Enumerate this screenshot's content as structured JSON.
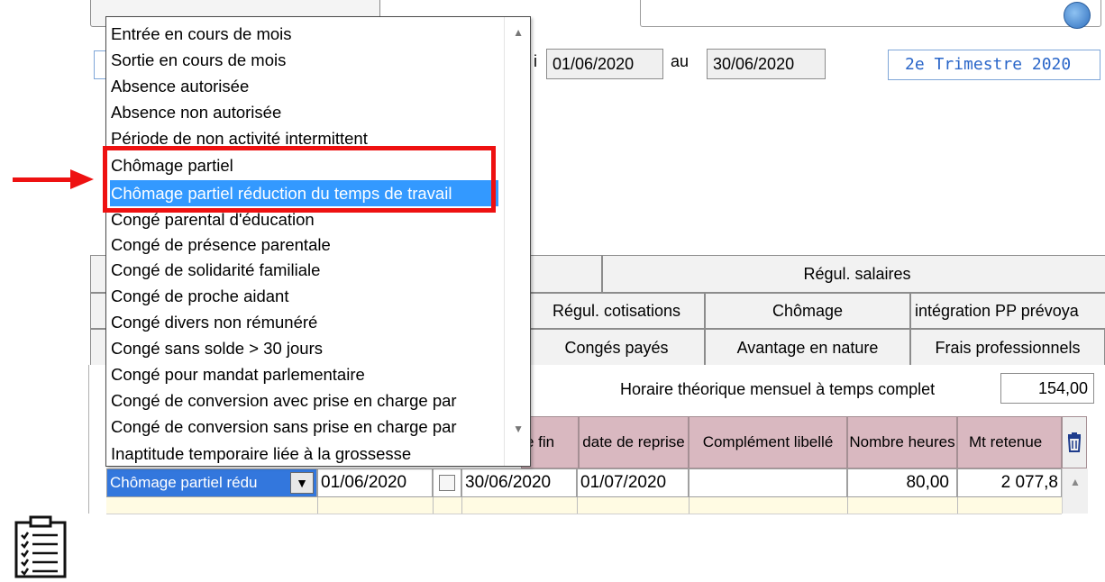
{
  "header": {
    "period_start": "01/06/2020",
    "period_to_label": "au",
    "period_end": "30/06/2020",
    "period_from_fragment": "i",
    "quarter": "2e Trimestre  2020"
  },
  "dropdown": {
    "options": [
      "Entrée en cours de mois",
      "Sortie en cours de mois",
      "Absence autorisée",
      "Absence non autorisée",
      "Période de non activité intermittent",
      "Chômage partiel",
      "Chômage partiel réduction du temps de travail",
      "Congé parental d'éducation",
      "Congé de présence parentale",
      "Congé de solidarité familiale",
      "Congé de proche aidant",
      "Congé divers non rémunéré",
      "Congé sans solde > 30 jours",
      "Congé pour mandat parlementaire",
      "Congé de conversion avec prise en charge par",
      "Congé de conversion sans prise en charge par",
      "Inaptitude temporaire liée à la grossesse"
    ],
    "selected_index": 6
  },
  "tabs": {
    "row1": [
      "",
      "Régul. salaires"
    ],
    "row2": [
      "Régul. cotisations",
      "Chômage",
      "intégration PP prévoya"
    ],
    "row3": [
      "Congés payés",
      "Avantage en nature",
      "Frais professionnels"
    ]
  },
  "horaire": {
    "label": "Horaire théorique mensuel à temps complet",
    "value": "154,00"
  },
  "grid": {
    "headers": {
      "fin": "e fin",
      "reprise": "date de reprise",
      "complement": "Complément libellé",
      "nb_heures": "Nombre heures",
      "mt_retenue": "Mt retenue"
    },
    "row": {
      "type": "Chômage partiel rédu",
      "debut": "01/06/2020",
      "fin": "30/06/2020",
      "reprise": "01/07/2020",
      "complement": "",
      "nb_heures": "80,00",
      "mt_retenue": "2 077,8"
    }
  },
  "colors": {
    "selection": "#3399ff",
    "annotation_red": "#ee1111",
    "grid_header": "#d9b8c0",
    "row_highlight": "#fffbe3"
  }
}
